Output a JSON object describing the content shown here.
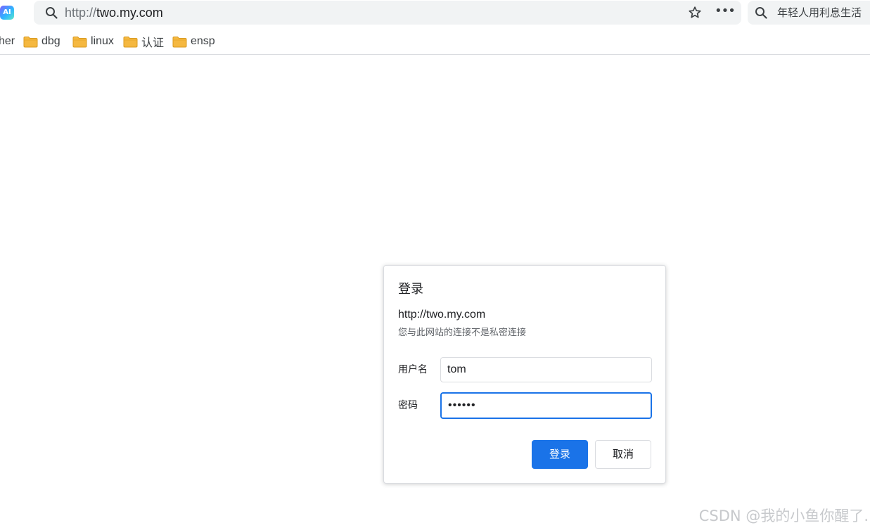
{
  "toolbar": {
    "ai_icon_label": "AI",
    "url_scheme": "http://",
    "url_host": "two.my.com",
    "more_label": "•••",
    "side_search_text": "年轻人用利息生活"
  },
  "bookmarks": {
    "cut_label": "her",
    "items": [
      {
        "label": "dbg"
      },
      {
        "label": "linux"
      },
      {
        "label": "认证"
      },
      {
        "label": "ensp"
      }
    ]
  },
  "dialog": {
    "title": "登录",
    "origin": "http://two.my.com",
    "warning": "您与此网站的连接不是私密连接",
    "username_label": "用户名",
    "username_value": "tom",
    "password_label": "密码",
    "password_value": "••••••",
    "login_button": "登录",
    "cancel_button": "取消"
  },
  "watermark": "CSDN @我的小鱼你醒了.",
  "colors": {
    "accent": "#1a73e8",
    "omnibox_bg": "#f1f3f4",
    "folder": "#f5b840"
  }
}
